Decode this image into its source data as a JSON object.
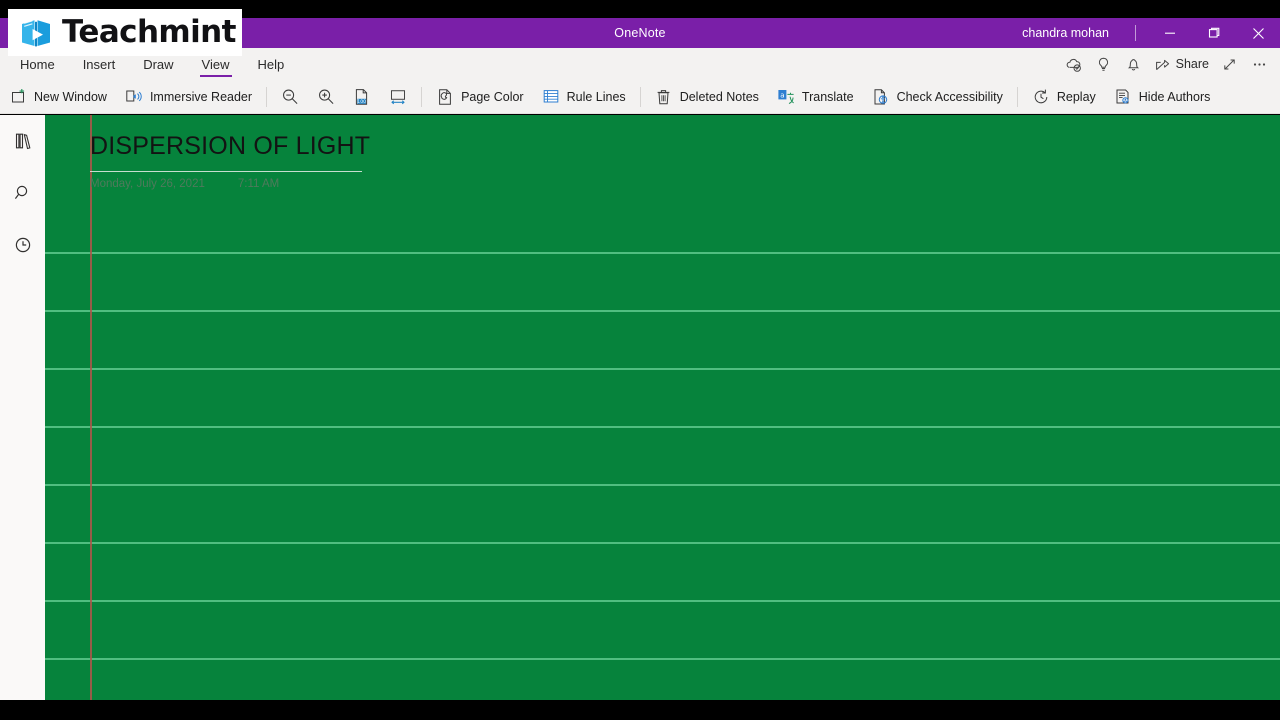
{
  "window": {
    "app_title": "OneNote",
    "user_name": "chandra mohan",
    "minimize_label": "Minimize",
    "restore_label": "Restore",
    "close_label": "Close",
    "titlebar_color": "#7a1fa8"
  },
  "brand": {
    "name": "Teachmint",
    "logo_icon": "teachmint-book-play-icon",
    "logo_color": "#2fa8e0"
  },
  "ribbon": {
    "tabs": [
      {
        "label": "Home",
        "active": false
      },
      {
        "label": "Insert",
        "active": false
      },
      {
        "label": "Draw",
        "active": false
      },
      {
        "label": "View",
        "active": true
      },
      {
        "label": "Help",
        "active": false
      }
    ],
    "active_tab": "View",
    "accent_color": "#7a1fa8",
    "quick_actions": [
      {
        "icon": "cloud-sync-icon",
        "label": ""
      },
      {
        "icon": "lightbulb-icon",
        "label": ""
      },
      {
        "icon": "bell-icon",
        "label": ""
      },
      {
        "icon": "share-icon",
        "label": "Share"
      },
      {
        "icon": "expand-arrow-icon",
        "label": ""
      },
      {
        "icon": "ellipsis-icon",
        "label": ""
      }
    ],
    "commands": [
      {
        "icon": "new-window-icon",
        "label": "New Window"
      },
      {
        "icon": "immersive-reader-icon",
        "label": "Immersive Reader"
      },
      {
        "icon": "zoom-out-icon",
        "label": ""
      },
      {
        "icon": "zoom-in-icon",
        "label": ""
      },
      {
        "icon": "page-zoom-100-icon",
        "label": ""
      },
      {
        "icon": "page-width-icon",
        "label": ""
      },
      {
        "icon": "page-color-icon",
        "label": "Page Color"
      },
      {
        "icon": "rule-lines-icon",
        "label": "Rule Lines"
      },
      {
        "icon": "deleted-notes-icon",
        "label": "Deleted Notes"
      },
      {
        "icon": "translate-icon",
        "label": "Translate"
      },
      {
        "icon": "check-accessibility-icon",
        "label": "Check Accessibility"
      },
      {
        "icon": "replay-icon",
        "label": "Replay"
      },
      {
        "icon": "hide-authors-icon",
        "label": "Hide Authors"
      }
    ]
  },
  "sidebar": {
    "items": [
      {
        "icon": "notebooks-icon",
        "label": "Notebooks"
      },
      {
        "icon": "search-icon",
        "label": "Search"
      },
      {
        "icon": "recent-notes-icon",
        "label": "Recent Notes"
      }
    ]
  },
  "note": {
    "title": "DISPERSION OF LIGHT",
    "date": "Monday, July 26, 2021",
    "time": "7:11 AM",
    "page_color": "#06833c",
    "rule_line_color": "#5ec98c",
    "margin_line_color": "#b0564a",
    "rule_lines_enabled": true,
    "body_text": ""
  }
}
